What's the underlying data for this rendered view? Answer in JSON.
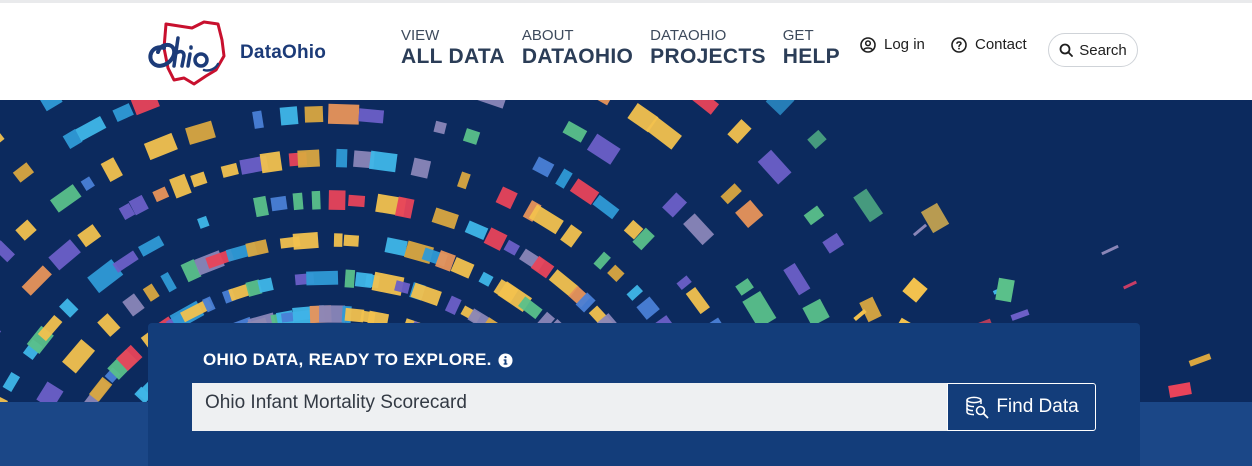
{
  "brand": {
    "logo_label": "DataOhio"
  },
  "nav": [
    {
      "small": "VIEW",
      "big": "ALL DATA"
    },
    {
      "small": "ABOUT",
      "big": "DATAOHIO"
    },
    {
      "small": "DATAOHIO",
      "big": "PROJECTS"
    },
    {
      "small": "GET",
      "big": "HELP"
    }
  ],
  "utility": {
    "login": "Log in",
    "contact": "Contact",
    "search": "Search"
  },
  "hero": {
    "title": "OHIO DATA, READY TO EXPLORE.",
    "search_value": "Ohio Infant Mortality Scorecard",
    "find_label": "Find Data"
  },
  "colors": {
    "navy": "#0c2a5e",
    "card": "#133d7a",
    "band": "#1b4787",
    "nav_text": "#2b3d57",
    "brand_red": "#c8102e"
  },
  "icons": [
    "ohio-logo",
    "user-circle-icon",
    "question-circle-icon",
    "search-icon",
    "info-icon",
    "database-search-icon"
  ]
}
